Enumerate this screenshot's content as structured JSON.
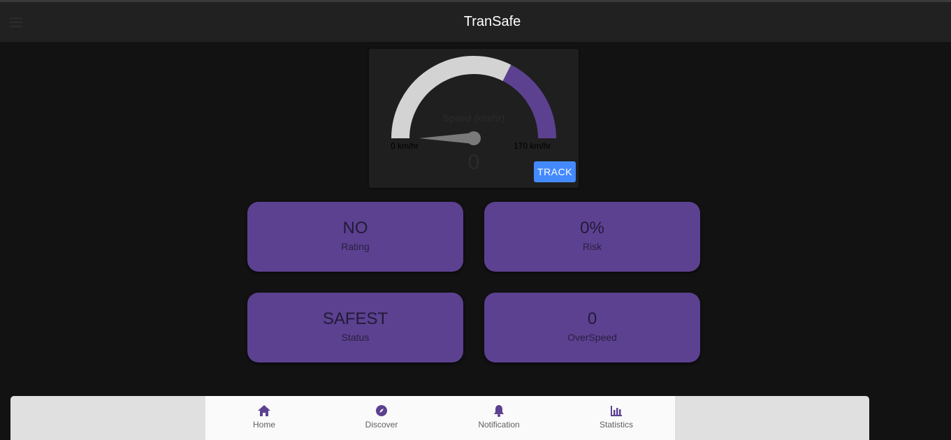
{
  "app": {
    "title": "TranSafe"
  },
  "colors": {
    "accent": "#5c4191",
    "button": "#448aff",
    "gauge_track": "#d3d3d3",
    "appbar": "#212121",
    "background": "#121212"
  },
  "gauge": {
    "label": "Speed (km/hr)",
    "value": "0",
    "min_label": "0 km/hr",
    "max_label": "170 km/hr",
    "min": 0,
    "max": 170,
    "current": 0,
    "warning_fraction": 0.3,
    "track_button": "TRACK"
  },
  "stats": [
    {
      "value": "NO",
      "label": "Rating"
    },
    {
      "value": "0%",
      "label": "Risk"
    },
    {
      "value": "SAFEST",
      "label": "Status"
    },
    {
      "value": "0",
      "label": "OverSpeed"
    }
  ],
  "nav": [
    {
      "label": "Home",
      "icon": "home-icon"
    },
    {
      "label": "Discover",
      "icon": "compass-icon"
    },
    {
      "label": "Notification",
      "icon": "bell-icon"
    },
    {
      "label": "Statistics",
      "icon": "bar-chart-icon"
    }
  ]
}
